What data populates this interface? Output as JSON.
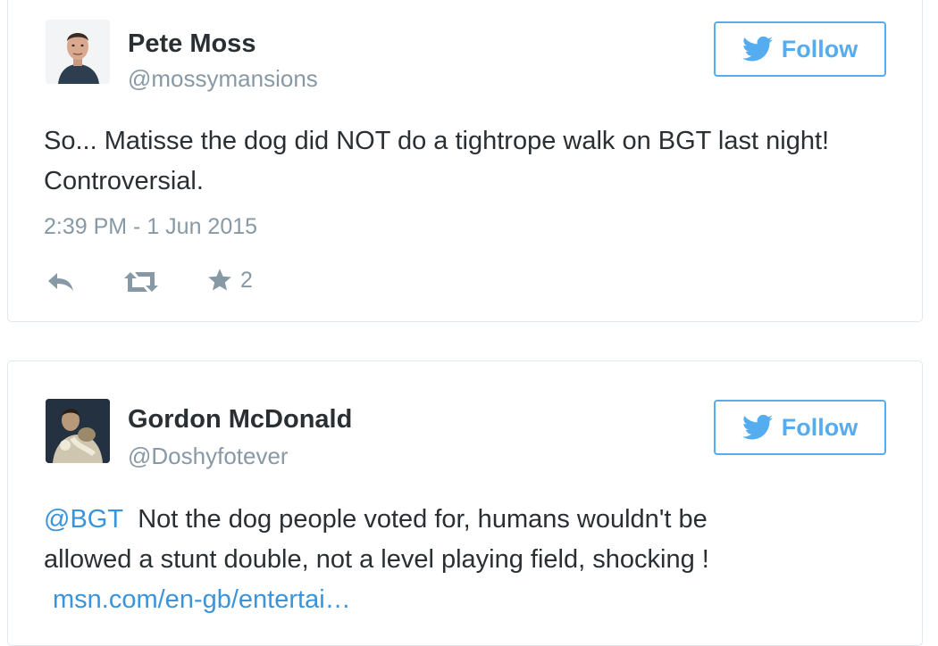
{
  "tweets": [
    {
      "display_name": "Pete Moss",
      "handle": "@mossymansions",
      "follow_label": "Follow",
      "text": "So... Matisse the dog did NOT do a tightrope walk on BGT last night! Controversial.",
      "timestamp": "2:39 PM - 1 Jun 2015",
      "favorite_count": "2",
      "icons": [
        "reply-icon",
        "retweet-icon",
        "favorite-star-icon",
        "twitter-bird-icon"
      ]
    },
    {
      "display_name": "Gordon McDonald",
      "handle": "@Doshyfotever",
      "follow_label": "Follow",
      "mention": "@BGT",
      "text_line1_rest": "Not the dog people voted for, humans wouldn't be",
      "text_line2": "allowed a stunt double, not a level playing field, shocking !",
      "link": "msn.com/en-gb/entertai…",
      "icons": [
        "twitter-bird-icon"
      ]
    }
  ],
  "colors": {
    "accent": "#55acee",
    "link": "#3b94d9",
    "text": "#292f33",
    "muted": "#8899a6",
    "border": "#e1e8ed"
  }
}
